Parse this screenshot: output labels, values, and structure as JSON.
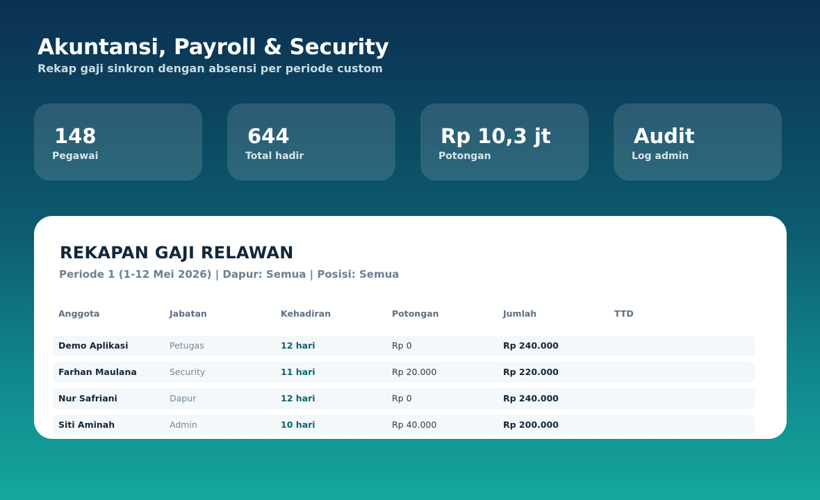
{
  "header": {
    "title": "Akuntansi, Payroll & Security",
    "subtitle": "Rekap gaji sinkron dengan absensi per periode custom"
  },
  "stats": [
    {
      "value": "148",
      "label": "Pegawai"
    },
    {
      "value": "644",
      "label": "Total hadir"
    },
    {
      "value": "Rp 10,3 jt",
      "label": "Potongan"
    },
    {
      "value": "Audit",
      "label": "Log admin"
    }
  ],
  "report": {
    "title": "REKAPAN GAJI RELAWAN",
    "period": "Periode 1 (1-12 Mei 2026) | Dapur: Semua | Posisi: Semua",
    "columns": [
      "Anggota",
      "Jabatan",
      "Kehadiran",
      "Potongan",
      "Jumlah",
      "TTD"
    ],
    "rows": [
      {
        "name": "Demo Aplikasi",
        "role": "Petugas",
        "attendance": "12 hari",
        "deduction": "Rp 0",
        "total": "Rp 240.000",
        "signature": ""
      },
      {
        "name": "Farhan Maulana",
        "role": "Security",
        "attendance": "11 hari",
        "deduction": "Rp 20.000",
        "total": "Rp 220.000",
        "signature": ""
      },
      {
        "name": "Nur Safriani",
        "role": "Dapur",
        "attendance": "12 hari",
        "deduction": "Rp 0",
        "total": "Rp 240.000",
        "signature": ""
      },
      {
        "name": "Siti Aminah",
        "role": "Admin",
        "attendance": "10 hari",
        "deduction": "Rp 40.000",
        "total": "Rp 200.000",
        "signature": ""
      }
    ]
  },
  "colors": {
    "background_top": "#0b3052",
    "background_bottom": "#14a79c",
    "attendance_accent": "#0e6275",
    "panel": "#ffffff"
  }
}
